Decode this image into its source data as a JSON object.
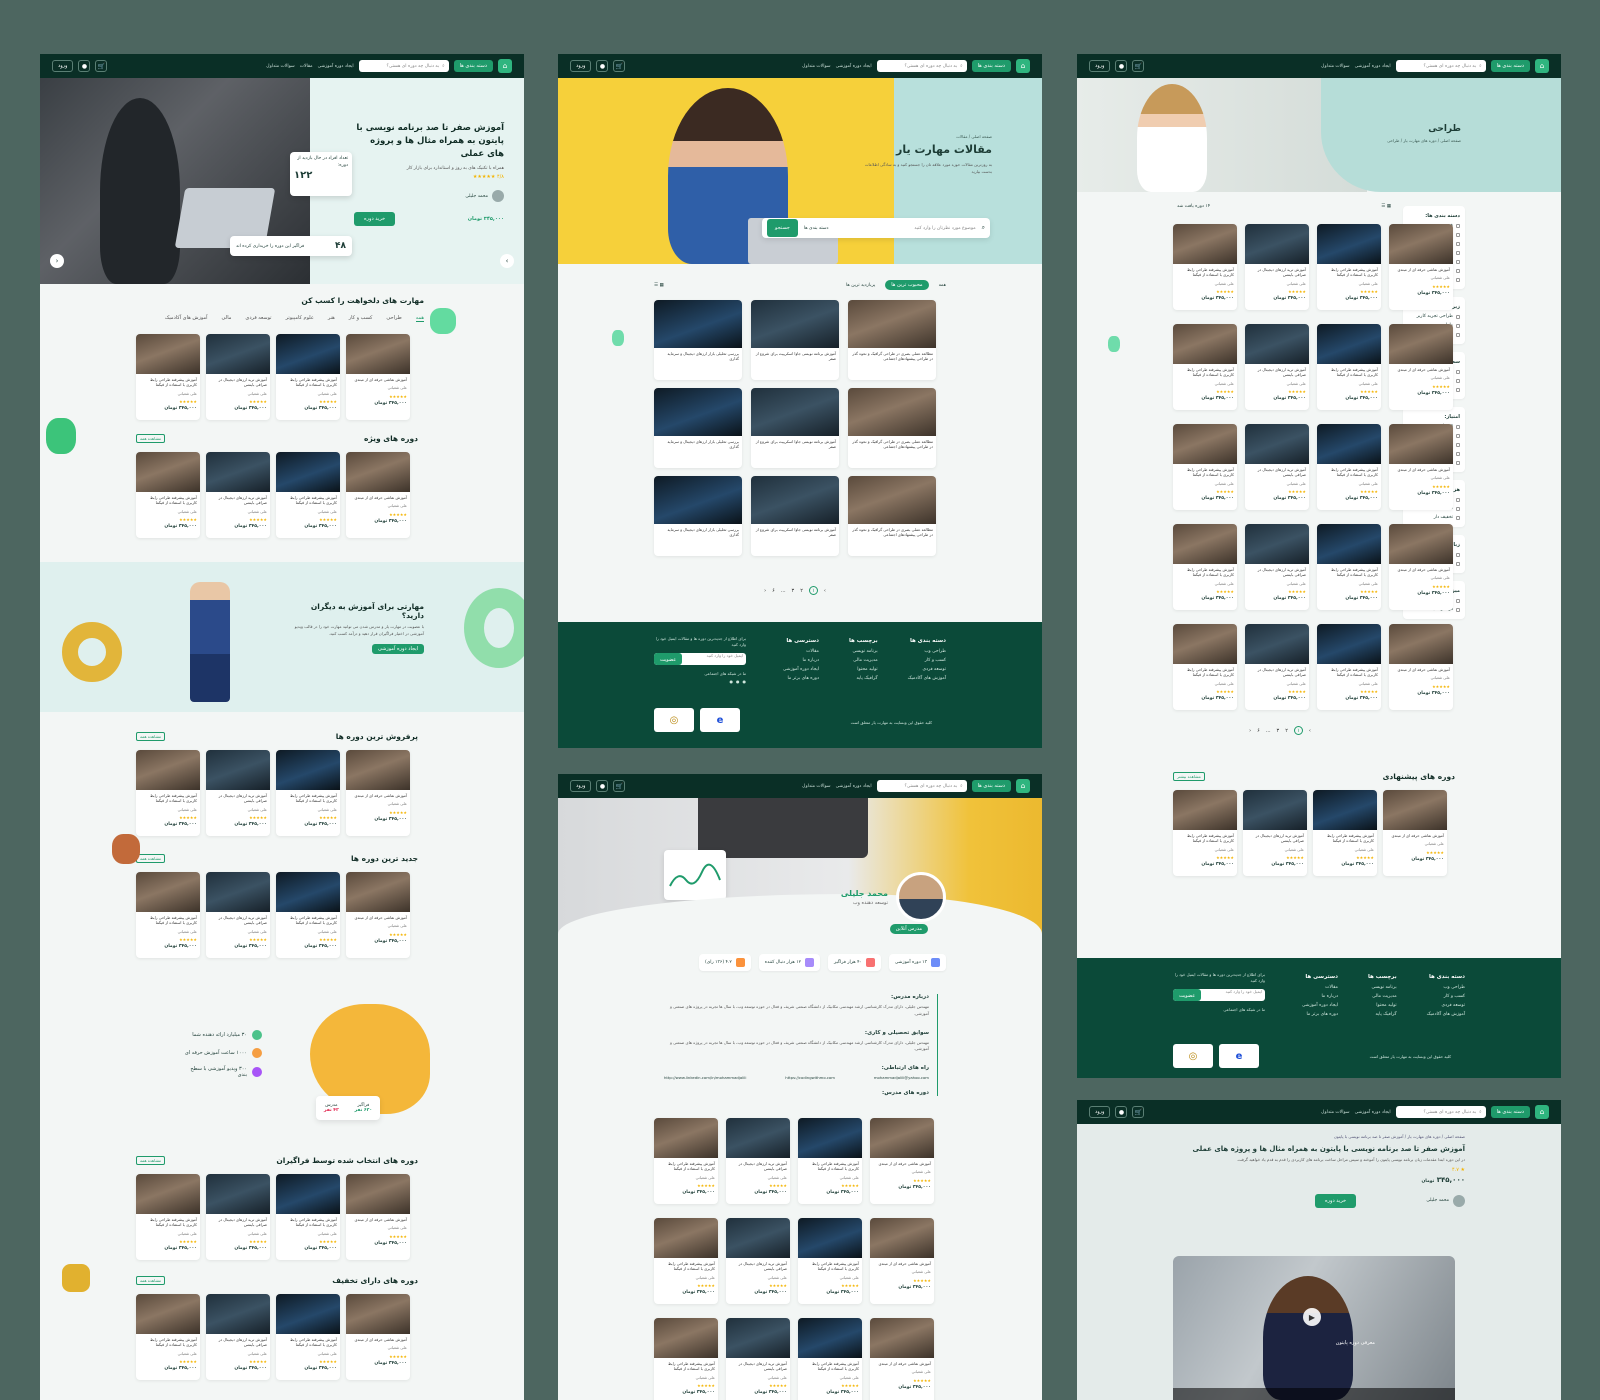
{
  "nav": {
    "logo": "مهارت یار",
    "categories": "دسته بندی ها",
    "search_placeholder": "به دنبال چه دوره ای هستی؟",
    "links": [
      "ایجاد دوره آموزشی",
      "مقالات",
      "سوالات متداول"
    ],
    "login": "ورود",
    "user_icon": "user-icon",
    "cart_icon": "cart-icon"
  },
  "home": {
    "hero": {
      "title": "آموزش صفر تا صد برنامه نویسی با پایتون به همراه مثال ها و پروژه های عملی",
      "subtitle": "همراه با تکنیک های به روز و استاندارد برای بازار کار",
      "rating": "۴/۸",
      "live_label": "تعداد افراد در حال بازدید از دوره:",
      "live_count": "۱۲۲",
      "buyers_count": "۴۸",
      "buyers_label": "فراگیر این دوره را خریداری کرده اند",
      "instructor": "محمد جلیلی",
      "price": "۳۴۵,۰۰۰",
      "currency": "تومان",
      "buy_button": "خرید دوره"
    },
    "skills_title": "مهارت های دلخواهت را کسب کن",
    "tabs": [
      "همه",
      "طراحی",
      "کسب و کار",
      "هنر",
      "علوم کامپیوتر",
      "توسعه فردی",
      "مالی",
      "آموزش های آکادمیک"
    ],
    "special_title": "دوره های ویژه",
    "see_all": "مشاهده همه",
    "teach_title": "مهارتی برای آموزش به دیگران دارید؟",
    "teach_text": "با عضویت در مهارت یار و مدرس شدن می توانید مهارت خود را در قالب ویدیو آموزشی در اختیار فراگیران قرار دهید و درآمد کسب کنید.",
    "teach_button": "ایجاد دوره آموزشی",
    "bestsellers_title": "پرفروش ترین دوره ها",
    "newest_title": "جدید ترین دوره ها",
    "stats": [
      {
        "label": "۳۰ میلیارد ارائه دهنده شما"
      },
      {
        "label": "۱۰۰۰ ساعت آموزش حرفه ای"
      },
      {
        "label": "۳۰۰ ویدیو آموزشی با سطح بندی"
      }
    ],
    "learners_label": "فراگیر",
    "learners_count": "۶۲۰ نفر",
    "teachers_label": "مدرس",
    "teachers_count": "۴۲ نفر",
    "picked_title": "دوره های انتخاب شده توسط فراگیران",
    "discount_title": "دوره های دارای تخفیف"
  },
  "card": {
    "title1": "آموزش نقاشی حرفه ای از مبتدی",
    "title2": "آموزش پیشرفته طراحی رابط کاربری با استفاده از فیگما",
    "title3": "آموزش ترید ارزهای دیجیتال در صرافی بایننس",
    "instructor": "علی شعبانی",
    "rating": "۴/۸",
    "price": "۳۴۵,۰۰۰",
    "currency": "تومان",
    "stars": "★★★★★"
  },
  "blog": {
    "breadcrumb": "صفحه اصلی / مقالات",
    "title": "مقالات مهارت یار",
    "text": "به روزترین مقالات حوزه مورد علاقه تان را جستجو کنید و به سادگی اطلاعات بدست بیارید",
    "search_placeholder": "موضوع مورد نظرتان را وارد کنید",
    "filter_label": "دسته بندی ها",
    "search_button": "جستجو",
    "sort_tabs": [
      "همه",
      "محبوب ترین ها",
      "پربازدید ترین ها"
    ],
    "article1": "مطالعه عملی بصری در طراحی گرافیک و نحوه گذر در طراحی پیشنهادهای اجتماعی",
    "article2": "آموزش برنامه نویسی جاوا اسکریپت برای شروع از صفر",
    "article3": "بررسی تحلیلی بازار ارزهای دیجیتال و سرمایه گذاری",
    "pages": [
      "۱",
      "۲",
      "۳",
      "...",
      "۶"
    ]
  },
  "footer": {
    "cols": [
      {
        "title": "دسته بندی ها",
        "items": [
          "طراحی وب",
          "کسب و کار",
          "توسعه فردی",
          "آموزش های آکادمیک"
        ]
      },
      {
        "title": "برچسب ها",
        "items": [
          "برنامه نویسی",
          "مدیریت مالی",
          "تولید محتوا",
          "گرافیک پایه"
        ]
      },
      {
        "title": "دسترسی ها",
        "items": [
          "مقالات",
          "درباره ما",
          "ایجاد دوره آموزشی",
          "دوره های برتر ما"
        ]
      }
    ],
    "newsletter": "برای اطلاع از جدیدترین دوره ها و مقالات ایمیل خود را وارد کنید",
    "email_placeholder": "ایمیل خود را وارد کنید",
    "subscribe": "عضویت",
    "social_label": "ما در شبکه های اجتماعی",
    "copyright": "کلیه حقوق این وبسایت به مهارت یار متعلق است"
  },
  "instructor": {
    "name": "محمد جلیلی",
    "role": "توسعه دهنده وب",
    "online": "مدرس آنلاین",
    "chips": [
      "۱۳ دوره آموزشی",
      "۴۰ هزار فراگیر",
      "۱۲ هزار دنبال کننده",
      "۴.۲ (۱۳۶ رای)"
    ],
    "about_title": "درباره مدرس:",
    "about_text": "مهندس جلیلی، دارای مدرک کارشناسی ارشد مهندسی مکانیک از دانشگاه صنعتی شریف و فعال در حوزه توسعه وب، با سال ها تجربه در پروژه های صنعتی و آموزشی.",
    "edu_title": "سوابق تحصیلی و کاری:",
    "contact_title": "راه های ارتباطی:",
    "courses_title": "دوره های مدرس:",
    "link1": "http://www.linkedin.com/in/mohammadjalili",
    "link2": "https://codingwithmo.com",
    "link3": "mohammadjalili@yahoo.com"
  },
  "category": {
    "title": "طراحی",
    "breadcrumb": "صفحه اصلی / دوره های مهارت یار / طراحی",
    "result": "۱۴ دوره یافت شد",
    "filters": [
      {
        "title": "دسته بندی ها:",
        "items": [
          "همه",
          "طراحی",
          "کسب و کار",
          "هنر",
          "علوم کامپیوتر",
          "توسعه فردی",
          "مالی"
        ]
      },
      {
        "title": "زیر مجموعه ها:",
        "items": [
          "طراحی تجربه کاربر",
          "طراحی وب",
          "طراحی گرافیک"
        ]
      },
      {
        "title": "سطح دوره:",
        "items": [
          "مبتدی",
          "متوسط",
          "پیشرفته"
        ]
      },
      {
        "title": "امتیاز:",
        "items": [
          "۵ ستاره",
          "۴ ستاره",
          "۳ ستاره",
          "۲ ستاره",
          "۱ ستاره"
        ]
      },
      {
        "title": "هزینه:",
        "items": [
          "رایگان",
          "غیر رایگان",
          "تخفیف دار"
        ]
      },
      {
        "title": "زبان:",
        "items": [
          "فارسی",
          "انگلیسی"
        ]
      },
      {
        "title": "میزان پیشرفت:",
        "items": [
          "پایان یافته",
          "در حال ضبط"
        ]
      }
    ],
    "suggested_title": "دوره های پیشنهادی",
    "show_more": "مشاهده بیشتر"
  },
  "detail": {
    "breadcrumb": "صفحه اصلی / دوره های مهارت یار / آموزش صفر تا صد برنامه نویسی با پایتون",
    "title": "آموزش صفر تا صد برنامه نویسی با پایتون به همراه مثال ها و پروژه های عملی",
    "text": "در این دوره ابتدا مقدمات زبان برنامه نویسی پایتون را آموخته و سپس مراحل ساخت برنامه های کاربردی را قدم به قدم یاد خواهید گرفت.",
    "rating": "۴.۷",
    "price": "۳۴۵,۰۰۰",
    "currency": "تومان",
    "buy": "خرید دوره",
    "instructor": "محمد جلیلی",
    "video_caption": "معرفی دوره پایتون"
  }
}
